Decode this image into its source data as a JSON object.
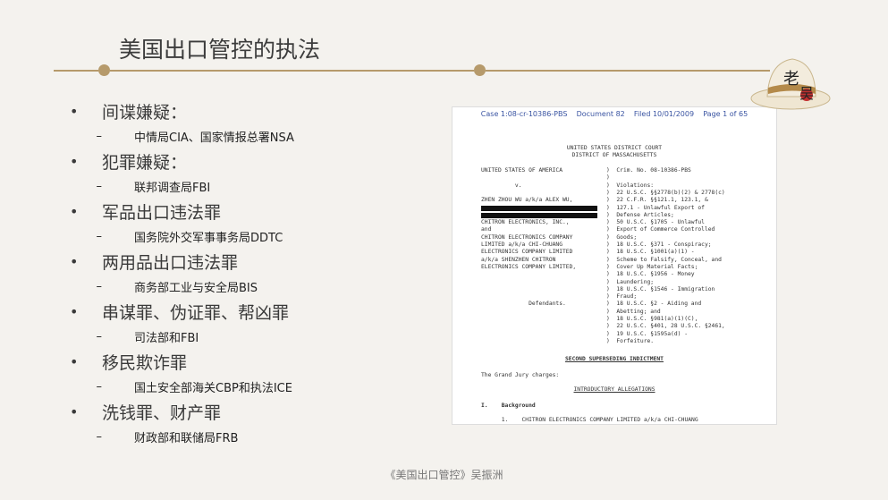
{
  "title": "美国出口管控的执法",
  "bullets": [
    {
      "main": "间谍嫌疑：",
      "sub": "中情局CIA、国家情报总署NSA"
    },
    {
      "main": "犯罪嫌疑：",
      "sub": "联邦调查局FBI"
    },
    {
      "main": "军品出口违法罪",
      "sub": "国务院外交军事事务局DDTC"
    },
    {
      "main": "两用品出口违法罪",
      "sub": "商务部工业与安全局BIS"
    },
    {
      "main": "串谋罪、伪证罪、帮凶罪",
      "sub": "司法部和FBI"
    },
    {
      "main": "移民欺诈罪",
      "sub": "国土安全部海关CBP和执法ICE"
    },
    {
      "main": "洗钱罪、财产罪",
      "sub": "财政部和联储局FRB"
    }
  ],
  "bullet_symbol": "•",
  "sub_symbol": "–",
  "document": {
    "header": "Case 1:08-cr-10386-PBS    Document 82    Filed 10/01/2009    Page 1 of 65",
    "court": [
      "UNITED STATES DISTRICT COURT",
      "DISTRICT OF MASSACHUSETTS"
    ],
    "left_col": [
      "UNITED STATES OF AMERICA",
      "",
      "          v.",
      "",
      "ZHEN ZHOU WU a/k/a ALEX WU,",
      "",
      "",
      "CHITRON ELECTRONICS, INC.,",
      "and",
      "CHITRON ELECTRONICS COMPANY",
      "LIMITED a/k/a CHI-CHUANG",
      "ELECTRONICS COMPANY LIMITED",
      "a/k/a SHENZHEN CHITRON",
      "ELECTRONICS COMPANY LIMITED,",
      "",
      "",
      "",
      "",
      "              Defendants."
    ],
    "right_col": [
      ")  Crim. No. 08-10386-PBS",
      ")",
      ")  Violations:",
      ")  22 U.S.C. §§2778(b)(2) & 2778(c)",
      ")  22 C.F.R. §§121.1, 123.1, &",
      ")  127.1 - Unlawful Export of",
      ")  Defense Articles;",
      ")  50 U.S.C. §1705 - Unlawful",
      ")  Export of Commerce Controlled",
      ")  Goods;",
      ")  18 U.S.C. §371 - Conspiracy;",
      ")  18 U.S.C. §1001(a)(1) -",
      ")  Scheme to Falsify, Conceal, and",
      ")  Cover Up Material Facts;",
      ")  18 U.S.C. §1956 - Money",
      ")  Laundering;",
      ")  18 U.S.C. §1546 - Immigration",
      ")  Fraud;",
      ")  18 U.S.C. §2 - Aiding and",
      ")  Abetting; and",
      ")  18 U.S.C. §981(a)(1)(C),",
      ")  22 U.S.C. §401, 28 U.S.C. §2461,",
      ")  19 U.S.C. §1595a(d) -",
      ")  Forfeiture."
    ],
    "indictment_title": "SECOND SUPERSEDING INDICTMENT",
    "grand_jury": "The Grand Jury charges:",
    "intro": "INTRODUCTORY ALLEGATIONS",
    "section": "I.    Background",
    "para": "      1.    CHITRON ELECTRONICS COMPANY LIMITED a/k/a CHI-CHUANG"
  },
  "logo": {
    "char1": "老",
    "char2": "吴"
  },
  "footer": "《美国出口管控》吴振洲",
  "colors": {
    "accent": "#b69a6b",
    "link": "#3a54a2"
  }
}
